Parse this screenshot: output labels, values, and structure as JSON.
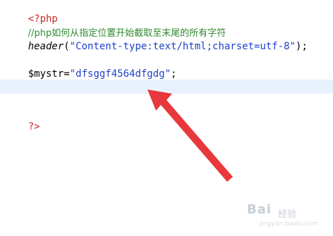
{
  "code": {
    "line1": "<?php",
    "line2": "//php如何从指定位置开始截取至末尾的所有字符",
    "line3_func": "header",
    "line3_open": "(",
    "line3_string": "\"Content-type:text/html;charset=utf-8\"",
    "line3_close": ");",
    "line5_var": "$mystr",
    "line5_eq": "=",
    "line5_string": "\"dfsggf4564dfgdg\"",
    "line5_end": ";",
    "line9": "?>"
  },
  "colors": {
    "tag": "#cc2a2a",
    "comment": "#2f8a2f",
    "string": "#1f3fc9",
    "current_line": "#e8f2fe",
    "arrow": "#e8383d"
  },
  "watermark": {
    "brand": "Bai",
    "sub": "经验",
    "url": "jingyan.baidu.com"
  }
}
